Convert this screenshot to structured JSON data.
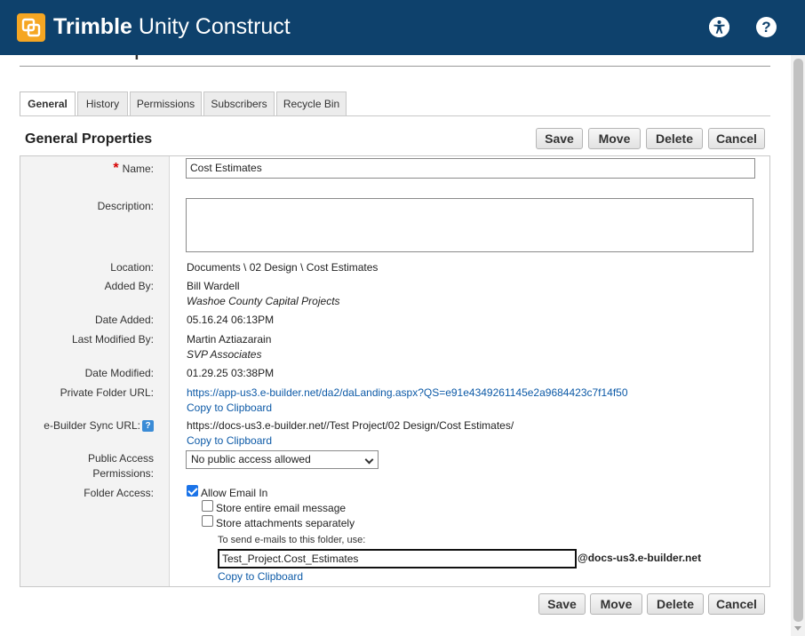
{
  "app": {
    "brand_bold": "Trimble",
    "brand_rest": " Unity Construct",
    "accessibility_icon": "accessibility-icon",
    "help_icon": "help-icon"
  },
  "page": {
    "title": "Folder Properties"
  },
  "tabs": [
    {
      "label": "General",
      "active": true
    },
    {
      "label": "History"
    },
    {
      "label": "Permissions"
    },
    {
      "label": "Subscribers"
    },
    {
      "label": "Recycle Bin"
    }
  ],
  "section": {
    "title": "General Properties"
  },
  "actions": {
    "save": "Save",
    "move": "Move",
    "delete": "Delete",
    "cancel": "Cancel"
  },
  "form": {
    "name": {
      "label": "Name:",
      "required_mark": "*",
      "value": "Cost Estimates"
    },
    "description": {
      "label": "Description:",
      "value": ""
    },
    "location": {
      "label": "Location:",
      "value": "Documents \\ 02 Design \\ Cost Estimates"
    },
    "added_by": {
      "label": "Added By:",
      "name": "Bill Wardell",
      "org": "Washoe County Capital Projects"
    },
    "date_added": {
      "label": "Date Added:",
      "value": "05.16.24 06:13PM"
    },
    "last_modified_by": {
      "label": "Last Modified By:",
      "name": "Martin Aztiazarain",
      "org": "SVP Associates"
    },
    "date_modified": {
      "label": "Date Modified:",
      "value": "01.29.25 03:38PM"
    },
    "private_url": {
      "label": "Private Folder URL:",
      "value": "https://app-us3.e-builder.net/da2/daLanding.aspx?QS=e91e4349261145e2a9684423c7f14f50",
      "copy": "Copy to Clipboard"
    },
    "sync_url": {
      "label": "e-Builder Sync URL:",
      "help": "?",
      "value": "https://docs-us3.e-builder.net//Test Project/02 Design/Cost Estimates/",
      "copy": "Copy to Clipboard"
    },
    "public_access": {
      "label_line1": "Public Access",
      "label_line2": "Permissions:",
      "selected": "No public access allowed"
    },
    "folder_access": {
      "label": "Folder Access:",
      "allow_email_in": {
        "label": "Allow Email In",
        "checked": true
      },
      "store_entire": {
        "label": "Store entire email message",
        "checked": false
      },
      "store_attachments": {
        "label": "Store attachments separately",
        "checked": false
      },
      "hint": "To send e-mails to this folder, use:",
      "email_local": "Test_Project.Cost_Estimates",
      "email_domain": "@docs-us3.e-builder.net",
      "copy": "Copy to Clipboard"
    }
  },
  "colors": {
    "header": "#0e416c",
    "logo": "#f5a623",
    "link": "#0d5aa7",
    "required": "#d60000"
  }
}
